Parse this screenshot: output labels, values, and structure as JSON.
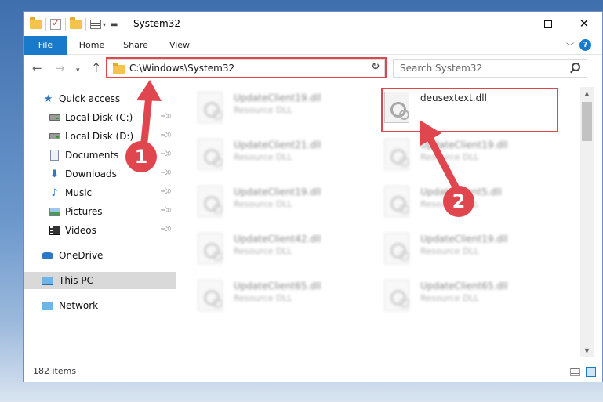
{
  "window": {
    "title": "System32"
  },
  "ribbon": {
    "tabs": [
      {
        "label": "File"
      },
      {
        "label": "Home"
      },
      {
        "label": "Share"
      },
      {
        "label": "View"
      }
    ],
    "help": "?"
  },
  "address_bar": {
    "path": "C:\\Windows\\System32"
  },
  "search": {
    "placeholder": "Search System32"
  },
  "sidebar": {
    "items": [
      {
        "label": "Quick access"
      },
      {
        "label": "Local Disk (C:)"
      },
      {
        "label": "Local Disk (D:)"
      },
      {
        "label": "Documents"
      },
      {
        "label": "Downloads"
      },
      {
        "label": "Music"
      },
      {
        "label": "Pictures"
      },
      {
        "label": "Videos"
      },
      {
        "label": "OneDrive"
      },
      {
        "label": "This PC"
      },
      {
        "label": "Network"
      }
    ]
  },
  "files": {
    "col1": [
      {
        "name": "UpdateClient19.dll",
        "type": "Resource DLL"
      },
      {
        "name": "UpdateClient21.dll",
        "type": "Resource DLL"
      },
      {
        "name": "UpdateClient19.dll",
        "type": "Resource DLL"
      },
      {
        "name": "UpdateClient42.dll",
        "type": "Resource DLL"
      },
      {
        "name": "UpdateClient65.dll",
        "type": "Resource DLL"
      }
    ],
    "col2": [
      {
        "name": "deusextext.dll",
        "type": ""
      },
      {
        "name": "UpdateClient19.dll",
        "type": "Resource DLL"
      },
      {
        "name": "UpdateClient5.dll",
        "type": "Resource DLL"
      },
      {
        "name": "UpdateClient19.dll",
        "type": "Resource DLL"
      },
      {
        "name": "UpdateClient65.dll",
        "type": "Resource DLL"
      }
    ]
  },
  "status": {
    "item_count": "182 items"
  },
  "annotations": {
    "step1": "1",
    "step2": "2",
    "color": "#e0464d"
  }
}
